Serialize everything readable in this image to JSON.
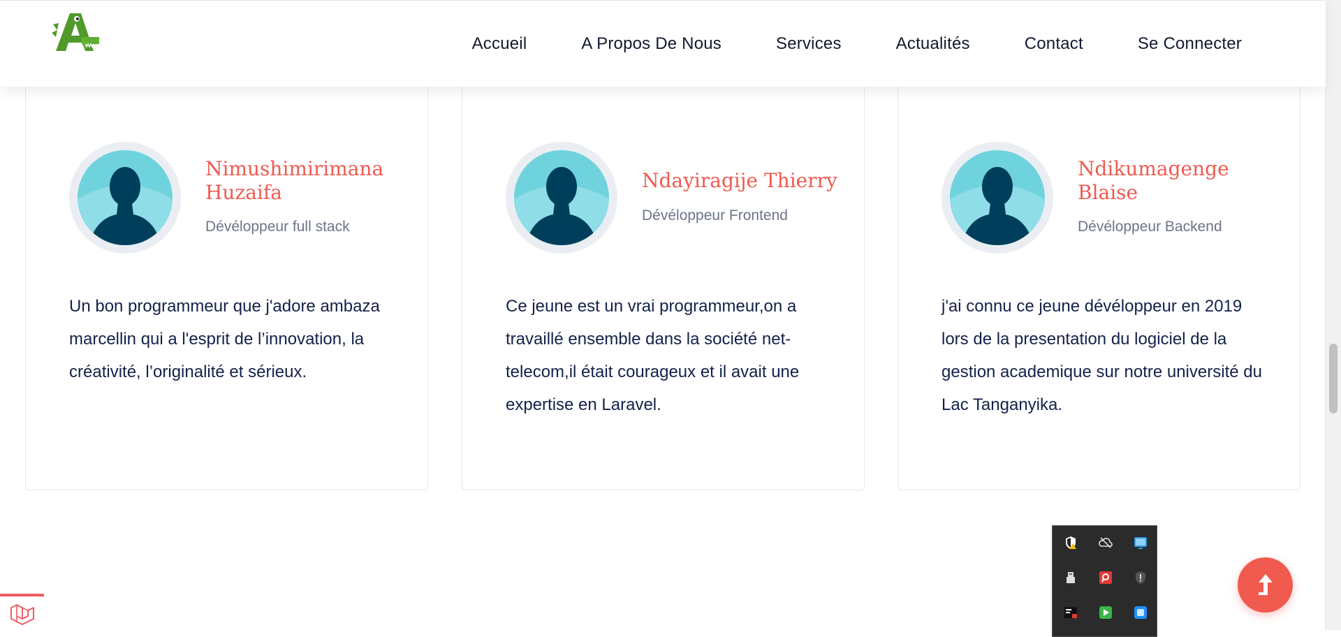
{
  "header": {
    "logo_alt": "A",
    "nav": [
      {
        "label": "Accueil"
      },
      {
        "label": "A Propos De Nous"
      },
      {
        "label": "Services"
      },
      {
        "label": "Actualités"
      },
      {
        "label": "Contact"
      },
      {
        "label": "Se Connecter"
      }
    ]
  },
  "testimonials": [
    {
      "name": "Nimushimirimana Huzaifa",
      "role": "Dévéloppeur full stack",
      "quote": "Un bon programmeur que j'adore ambaza marcellin qui a l'esprit de l’innovation, la créativité, l’originalité et sérieux."
    },
    {
      "name": "Ndayiragije Thierry",
      "role": "Dévéloppeur Frontend",
      "quote": "Ce jeune est un vrai programmeur,on a travaillé ensemble dans la société net-telecom,il était courageux et il avait une expertise en Laravel."
    },
    {
      "name": "Ndikumagenge Blaise",
      "role": "Dévéloppeur Backend",
      "quote": "j'ai connu ce jeune dévéloppeur en 2019 lors de la presentation du logiciel de la gestion academique sur notre université du Lac Tanganyika."
    }
  ],
  "icons": {
    "logo": "crocodile-a-logo-icon",
    "avatar": "user-silhouette-icon",
    "to_top": "arrow-up-icon",
    "laravel": "laravel-icon"
  },
  "tray_icons": [
    "security-warning-icon",
    "cloud-offline-icon",
    "network-monitor-icon",
    "usb-icon",
    "remote-desktop-icon",
    "shield-icon",
    "terminal-icon",
    "media-player-icon",
    "app-square-icon"
  ],
  "colors": {
    "accent": "#ef5a50",
    "text": "#14224a",
    "muted": "#6c7489"
  }
}
